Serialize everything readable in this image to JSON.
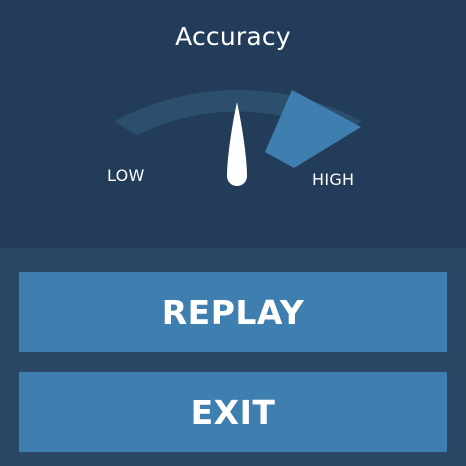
{
  "header": {
    "title": "Accuracy"
  },
  "gauge": {
    "low_label": "LOW",
    "high_label": "HIGH",
    "level": 0.5,
    "highlight_segment": "high",
    "colors": {
      "track": "#2c4f6e",
      "highlight": "#3f7fb0",
      "needle": "#ffffff"
    }
  },
  "actions": {
    "replay_label": "REPLAY",
    "exit_label": "EXIT"
  },
  "colors": {
    "background": "#2a4866",
    "panel": "#223c59",
    "button": "#3f7fb0",
    "text": "#ffffff"
  }
}
